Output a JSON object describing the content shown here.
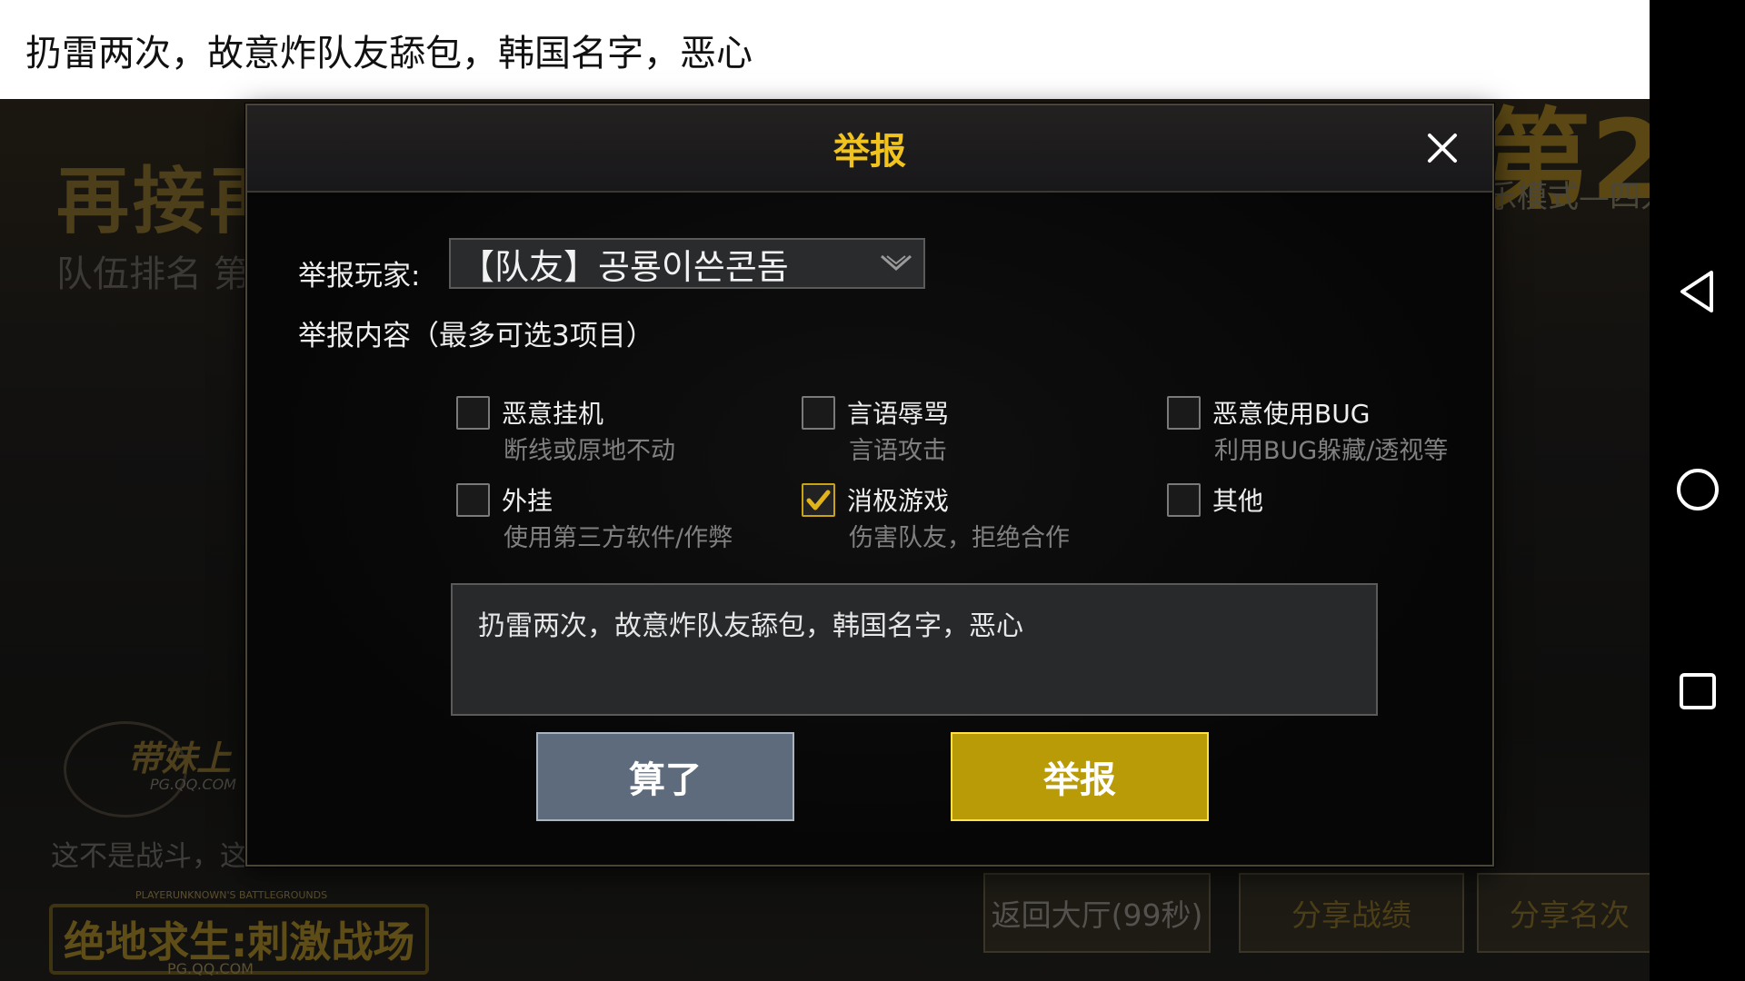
{
  "banner": {
    "text": "扔雷两次，故意炸队友舔包，韩国名字，恶心"
  },
  "background": {
    "mode_title": "再接再",
    "rank_label": "队伍排名  第",
    "rank_number": "第2",
    "mode_subtitle": "乐模式—四人",
    "slogan": "这不是战斗，这",
    "sub_logo": "带妹上",
    "sub_logo_url": "PG.QQ.COM",
    "game_logo_small": "PLAYERUNKNOWN'S BATTLEGROUNDS",
    "game_logo": "绝地求生:刺激战场",
    "game_logo_url": "PG.QQ.COM",
    "buttons": {
      "return": "返回大厅(99秒)",
      "share_stats": "分享战绩",
      "share_rank": "分享名次"
    }
  },
  "dialog": {
    "title": "举报",
    "player_label": "举报玩家:",
    "player_value": "【队友】공룡이쓴콘돔",
    "content_label": "举报内容（最多可选3项目）",
    "options": [
      {
        "title": "恶意挂机",
        "desc": "断线或原地不动",
        "checked": false
      },
      {
        "title": "言语辱骂",
        "desc": "言语攻击",
        "checked": false
      },
      {
        "title": "恶意使用BUG",
        "desc": "利用BUG躲藏/透视等",
        "checked": false
      },
      {
        "title": "外挂",
        "desc": "使用第三方软件/作弊",
        "checked": false
      },
      {
        "title": "消极游戏",
        "desc": "伤害队友，拒绝合作",
        "checked": true
      },
      {
        "title": "其他",
        "desc": "",
        "checked": false
      }
    ],
    "report_text": "扔雷两次，故意炸队友舔包，韩国名字，恶心",
    "cancel_label": "算了",
    "submit_label": "举报"
  },
  "colors": {
    "accent_gold": "#f0c31f",
    "submit_bg": "#b89b06",
    "cancel_bg": "#5e6b7c",
    "check_mark": "#e0b41a"
  },
  "icons": {
    "close": "close-icon",
    "dropdown": "chevron-down-icon",
    "checkbox_checked": "checkmark-icon",
    "nav_back": "back-triangle-icon",
    "nav_home": "home-circle-icon",
    "nav_recent": "recent-apps-square-icon"
  }
}
